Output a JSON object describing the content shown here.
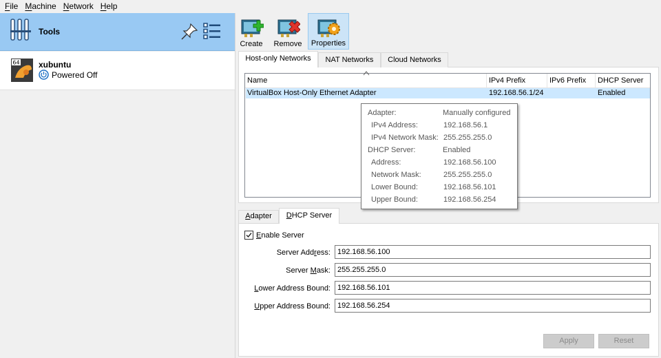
{
  "menubar": {
    "items": [
      {
        "first": "F",
        "rest": "ile"
      },
      {
        "first": "M",
        "rest": "achine"
      },
      {
        "first": "N",
        "rest": "etwork"
      },
      {
        "first": "H",
        "rest": "elp"
      }
    ]
  },
  "sidebar": {
    "tools_label": "Tools",
    "vm": {
      "name": "xubuntu",
      "state": "Powered Off",
      "badge": "64"
    }
  },
  "toolbar": {
    "create_label": "Create",
    "remove_label": "Remove",
    "properties_label": "Properties"
  },
  "top_tabs": [
    "Host-only Networks",
    "NAT Networks",
    "Cloud Networks"
  ],
  "table": {
    "columns": [
      "Name",
      "IPv4 Prefix",
      "IPv6 Prefix",
      "DHCP Server"
    ],
    "rows": [
      {
        "name": "VirtualBox Host-Only Ethernet Adapter",
        "ipv4": "192.168.56.1/24",
        "ipv6": "",
        "dhcp": "Enabled"
      }
    ]
  },
  "tooltip": {
    "rows": [
      {
        "key": "Adapter:",
        "value": "Manually configured",
        "indent": false
      },
      {
        "key": "IPv4 Address:",
        "value": "192.168.56.1",
        "indent": true
      },
      {
        "key": "IPv4 Network Mask:",
        "value": "255.255.255.0",
        "indent": true
      },
      {
        "key": "DHCP Server:",
        "value": "Enabled",
        "indent": false
      },
      {
        "key": "Address:",
        "value": "192.168.56.100",
        "indent": true
      },
      {
        "key": "Network Mask:",
        "value": "255.255.255.0",
        "indent": true
      },
      {
        "key": "Lower Bound:",
        "value": "192.168.56.101",
        "indent": true
      },
      {
        "key": "Upper Bound:",
        "value": "192.168.56.254",
        "indent": true
      }
    ]
  },
  "bottom_tabs": {
    "adapter": {
      "first": "A",
      "rest": "dapter"
    },
    "dhcp": {
      "first": "D",
      "rest": "HCP Server"
    }
  },
  "dhcp_form": {
    "enable_server": {
      "first": "E",
      "rest": "nable Server",
      "checked": true
    },
    "server_address": {
      "label_pre": "Server Add",
      "label_ul": "r",
      "label_post": "ess:",
      "value": "192.168.56.100"
    },
    "server_mask": {
      "label_pre": "Server ",
      "label_ul": "M",
      "label_post": "ask:",
      "value": "255.255.255.0"
    },
    "lower_bound": {
      "label_pre": "",
      "label_ul": "L",
      "label_post": "ower Address Bound:",
      "value": "192.168.56.101"
    },
    "upper_bound": {
      "label_pre": "",
      "label_ul": "U",
      "label_post": "pper Address Bound:",
      "value": "192.168.56.254"
    }
  },
  "buttons": {
    "apply": "Apply",
    "reset": "Reset"
  },
  "colors": {
    "tools_bg": "#99c9f3",
    "selection": "#cce8ff",
    "create_green": "#2fb52f",
    "remove_red": "#e0352b",
    "gear_orange": "#f2a21b"
  }
}
